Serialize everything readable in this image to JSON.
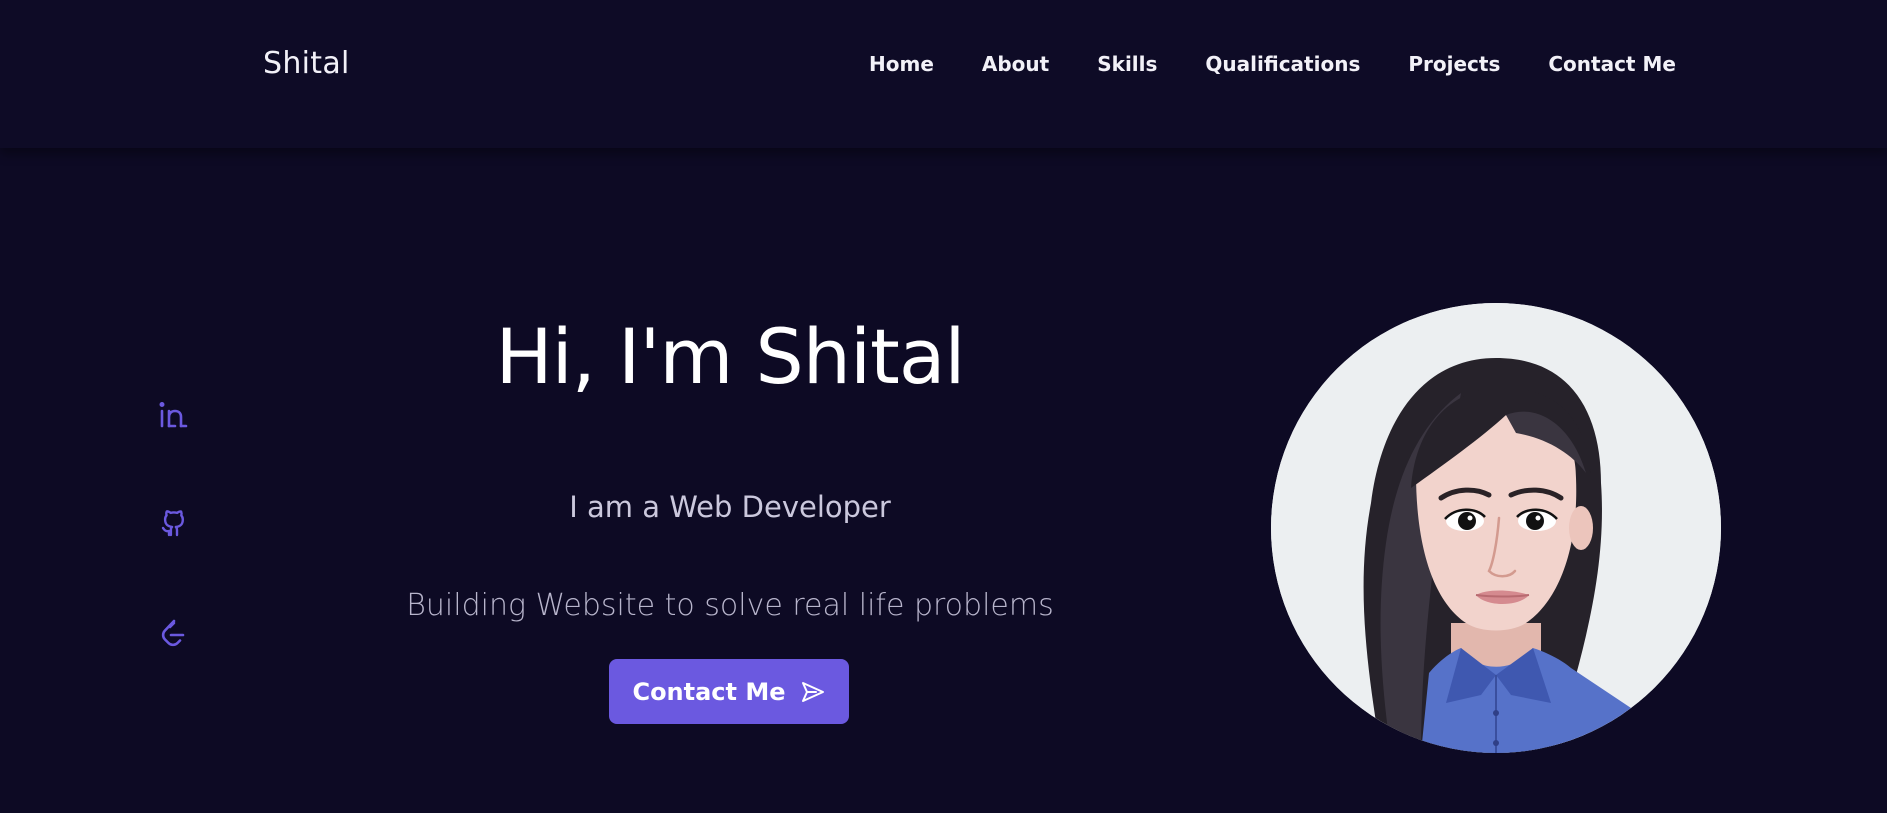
{
  "brand": {
    "name": "Shital"
  },
  "nav": {
    "items": [
      {
        "label": "Home"
      },
      {
        "label": "About"
      },
      {
        "label": "Skills"
      },
      {
        "label": "Qualifications"
      },
      {
        "label": "Projects"
      },
      {
        "label": "Contact Me"
      }
    ]
  },
  "social": {
    "items": [
      {
        "icon": "linkedin-icon"
      },
      {
        "icon": "github-icon"
      },
      {
        "icon": "leetcode-icon"
      }
    ],
    "color": "#6b59e0"
  },
  "hero": {
    "title": "Hi, I'm Shital",
    "role": "I am a Web Developer",
    "description": "Building Website to solve real life problems",
    "cta_label": "Contact Me",
    "cta_icon": "send-icon"
  },
  "colors": {
    "background": "#0d0a24",
    "accent": "#6b59e0"
  }
}
